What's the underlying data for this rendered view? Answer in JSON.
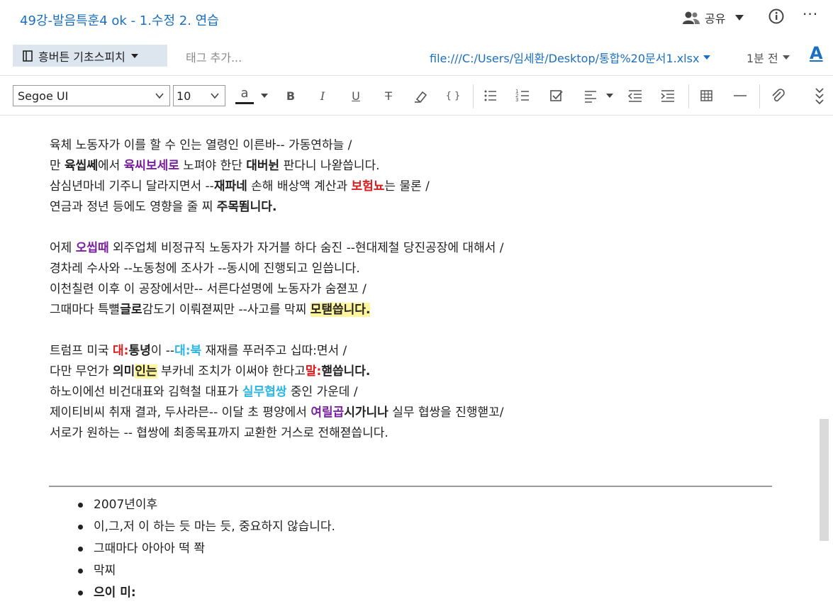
{
  "header": {
    "title": "49강-발음특훈4 ok - 1.수정 2. 연습",
    "share_label": "공유",
    "more_label": "···"
  },
  "meta_bar": {
    "notebook": "흥버튼 기초스피치",
    "tag_placeholder": "태그 추가...",
    "file_link": "file:///C:/Users/임세환/Desktop/통합%20문서1.xlsx",
    "timestamp": "1분 전",
    "font_icon_label": "A"
  },
  "toolbar": {
    "font_family": "Segoe UI",
    "font_size": "10",
    "font_color_label": "a",
    "bold": "B",
    "italic": "I",
    "underline": "U",
    "strike": "T",
    "code": "{ }"
  },
  "body": {
    "p1": {
      "l1": {
        "a": "육체 노동자가 이를 할 수 인는 열령인 이른바-- 가동연하늘 /"
      },
      "l2": {
        "a": "만 ",
        "b": "육씹쎄",
        "c": "에서 ",
        "d": "육씨보세로",
        "e": " 노펴야 한단 ",
        "f": "대버뉜",
        "g": " 판다니 나왇씁니다."
      },
      "l3": {
        "a": "삼심년마네 기주니 달라지면서 --",
        "b": "재파네",
        "c": " 손해 배상액 계산과 ",
        "d": "보험뇨",
        "e": "는 물론 /"
      },
      "l4": {
        "a": "연금과 정년 등에도 영향을 줄 찌 ",
        "b": "주목뙴니다."
      }
    },
    "p2": {
      "l1": {
        "a": "어제 ",
        "b": "오씹때",
        "c": " 외주업체 비정규직 노동자가 자거블 하다 숨진 --현대제철 당진공장에 대해서 /"
      },
      "l2": {
        "a": "경차레 수사와 --노동청에 조사가 --동시에 진행되고 읻씁니다."
      },
      "l3": {
        "a": "이천칠련 이후 이 공장에서만-- 서른다섣명에 노동자가 숨젿꼬 /"
      },
      "l4": {
        "a": "그때마다 특뼐",
        "b": "글로",
        "c": "감도기 이뤄젿찌만 --사고를 막찌 ",
        "d": "모탣씁니다."
      }
    },
    "p3": {
      "l1": {
        "a": "트럼프 미국 ",
        "b": "대:",
        "c": "통녕",
        "d": "이 --",
        "e": "대:북",
        "f": " 재재를 푸러주고 십따:면서 /"
      },
      "l2": {
        "a": "다만 무언가 ",
        "b": "의미",
        "c": "인는",
        "d": " 부카네 조치가 이써야 한다고",
        "e": "말:",
        "f": "핻씁니다."
      },
      "l3": {
        "a": "하노이에선 비건대표와 김혁철 대표가 ",
        "b": "실무협쌍",
        "c": " 중인 가운데 /"
      },
      "l4": {
        "a": "제이티비씨 취재 결과, 두사라믄-- 이달 초 평양에서 ",
        "b": "여릴곱",
        "c": "시가니나",
        "d": " 실무 협쌍을 진행핻꼬/"
      },
      "l5": {
        "a": "서로가 원하는 -- 협쌍에 최종목표까지 교환한 거스로 전해젿씁니다."
      }
    },
    "list": [
      "2007년이후",
      "이,그,저  이 하는 듯 마는 듯, 중요하지 않습니다.",
      "그때마다 아아아 떡 쫙",
      "막찌",
      "으이 미:"
    ]
  },
  "colors": {
    "accent_blue": "#1b6fc2",
    "purple": "#7b1fa2",
    "red": "#e01b1b",
    "cyan": "#29b6e8",
    "highlight": "#fff59d"
  }
}
